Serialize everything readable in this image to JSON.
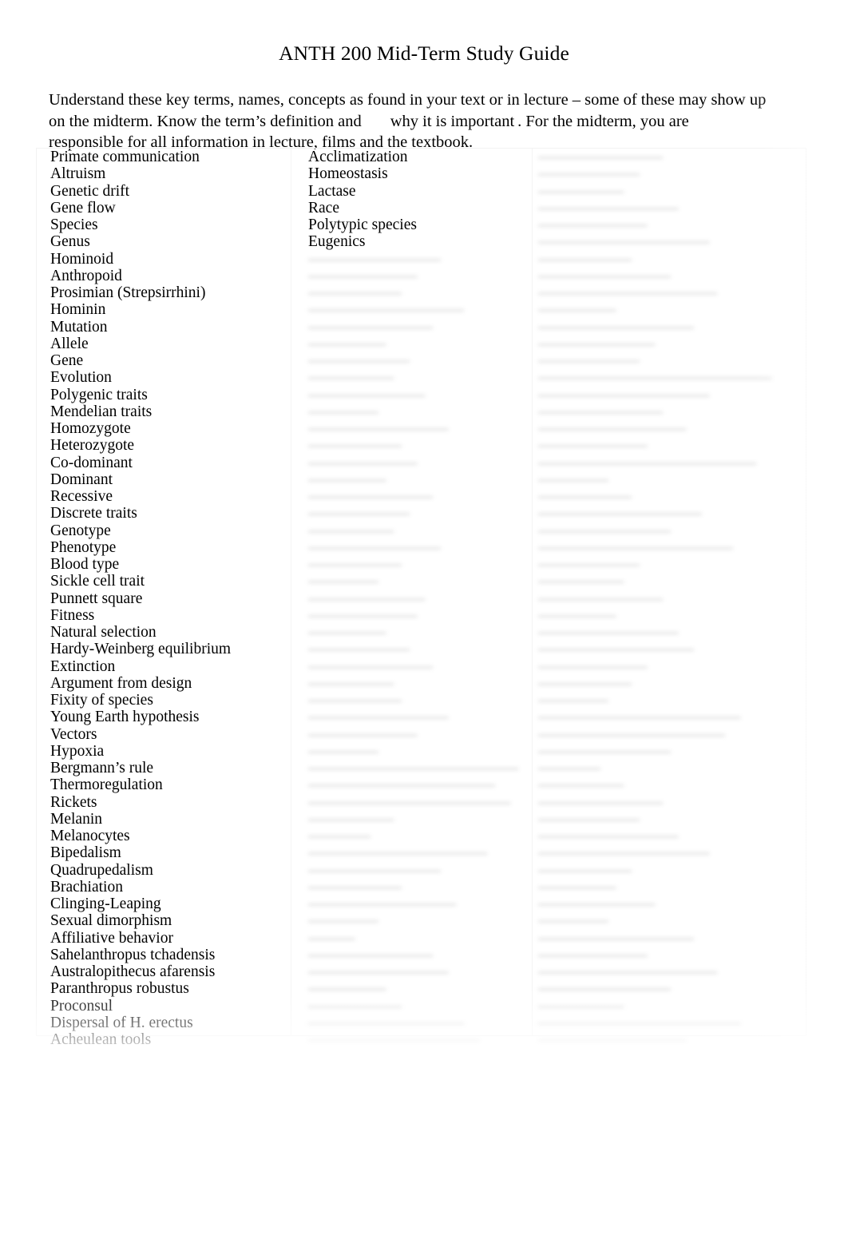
{
  "document": {
    "title": "ANTH 200 Mid-Term Study Guide",
    "intro": {
      "part1": "Understand these key terms, names, concepts as found in your text or in lecture – some of these may show up on the midterm. Know the term’s definition and",
      "part2": "why it is important",
      "part3": ". For the midterm, you are responsible for all information in lecture, films and the textbook."
    },
    "columns": {
      "column_1": [
        "Primate communication",
        "Altruism",
        "Genetic drift",
        "Gene flow",
        "Species",
        "Genus",
        "Hominoid",
        "Anthropoid",
        "Prosimian (Strepsirrhini)",
        "Hominin",
        "Mutation",
        "Allele",
        "Gene",
        "Evolution",
        "Polygenic traits",
        "Mendelian traits",
        "Homozygote",
        "Heterozygote",
        "Co-dominant",
        "Dominant",
        "Recessive",
        "Discrete traits",
        "Genotype",
        "Phenotype",
        "Blood type",
        "Sickle cell trait",
        "Punnett square",
        "Fitness",
        "Natural selection",
        "Hardy-Weinberg equilibrium",
        "Extinction",
        "Argument from design",
        "Fixity of species",
        "Young Earth hypothesis",
        "Vectors",
        "Hypoxia",
        "Bergmann’s rule",
        "Thermoregulation",
        "Rickets",
        "Melanin",
        "Melanocytes",
        "Bipedalism",
        "Quadrupedalism",
        "Brachiation",
        "Clinging-Leaping",
        "Sexual dimorphism",
        "Affiliative behavior",
        "Sahelanthropus tchadensis",
        "Australopithecus afarensis",
        "Paranthropus robustus",
        "Proconsul",
        "Dispersal of H. erectus",
        "Acheulean tools"
      ],
      "column_2_legible": [
        "Acclimatization",
        "Homeostasis",
        "Lactase",
        "Race",
        "Polytypic species",
        "Eugenics"
      ],
      "column_2_illegible_line_count": 47,
      "column_3_illegible_line_count": 53
    }
  }
}
